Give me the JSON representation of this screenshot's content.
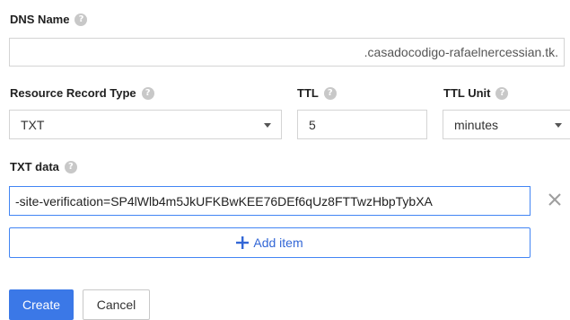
{
  "dns_name": {
    "label": "DNS Name",
    "suffix": ".casadocodigo-rafaelnercessian.tk."
  },
  "resource_record_type": {
    "label": "Resource Record Type",
    "value": "TXT"
  },
  "ttl": {
    "label": "TTL",
    "value": "5"
  },
  "ttl_unit": {
    "label": "TTL Unit",
    "value": "minutes"
  },
  "txt_data": {
    "label": "TXT data",
    "value": "-site-verification=SP4lWlb4m5JkUFKBwKEE76DEf6qUz8FTTwzHbpTybXA"
  },
  "add_item": {
    "label": "Add item"
  },
  "actions": {
    "create_label": "Create",
    "cancel_label": "Cancel"
  },
  "colors": {
    "accent": "#4285f4",
    "primary_button": "#3b78e7"
  },
  "icons": {
    "help": "help-circle-icon",
    "remove": "close-icon",
    "add": "plus-icon",
    "dropdown": "triangle-down-icon"
  }
}
